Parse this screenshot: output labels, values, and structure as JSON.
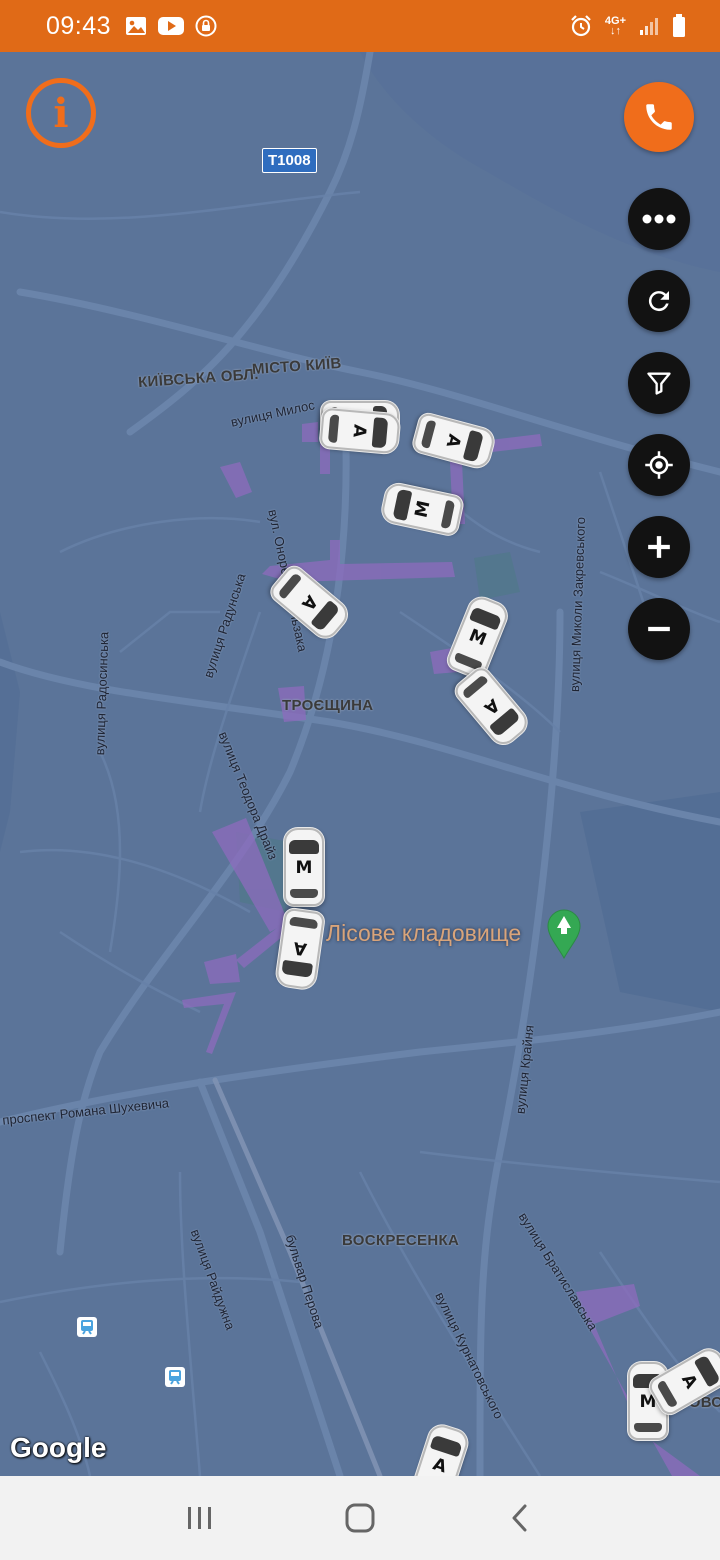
{
  "status_bar": {
    "time": "09:43",
    "left_icons": [
      "image-icon",
      "youtube-icon",
      "vpn-lock-icon"
    ],
    "network_label_top": "4G+",
    "network_label_bottom": "↓↑",
    "right_icons": [
      "alarm-icon",
      "signal-icon",
      "battery-icon"
    ],
    "background": "#e06a17"
  },
  "map": {
    "background": "#5b7499",
    "route_shield": "T1008",
    "labels": {
      "region": "КИЇВСЬКА ОБЛ.",
      "city": "МІСТО КИЇВ",
      "troieshchyna": "ТРОЄЩИНА",
      "voskresenka": "ВОСКРЕСЕНКА",
      "voskresenka_partial": "СОВС",
      "poi": "Лісове кладовище"
    },
    "streets": {
      "milosha": "вулиця Милос",
      "balzaka": "вул. Оноре де Бальзака",
      "zakrevskoho": "вулиця Миколи Закревського",
      "radunska": "вулиця Радунська",
      "radosynska": "вулиця Радосинська",
      "draizera": "вулиця Теодора Драйз",
      "kraina": "вулиця Крайня",
      "shukhevycha": "проспект Романа Шухевича",
      "raiduzhna": "вулиця Райдужна",
      "perova": "бульвар Перова",
      "kurnatovskoho": "вулиця Курнатовського",
      "bratyslavska": "вулиця Братиславська"
    },
    "attribution": "Google",
    "cars": [
      "А",
      "А",
      "А",
      "М",
      "А",
      "М",
      "А",
      "М",
      "А",
      "М",
      "А",
      "А"
    ]
  },
  "controls": {
    "info": "i",
    "call_icon": "phone-icon",
    "buttons": [
      "more-icon",
      "refresh-icon",
      "filter-icon",
      "locate-icon",
      "zoom-in-icon",
      "zoom-out-icon"
    ],
    "accent_color": "#f06d1b",
    "button_color": "#121212"
  },
  "nav_bar": {
    "buttons": [
      "recent-apps-icon",
      "home-icon",
      "back-icon"
    ]
  }
}
